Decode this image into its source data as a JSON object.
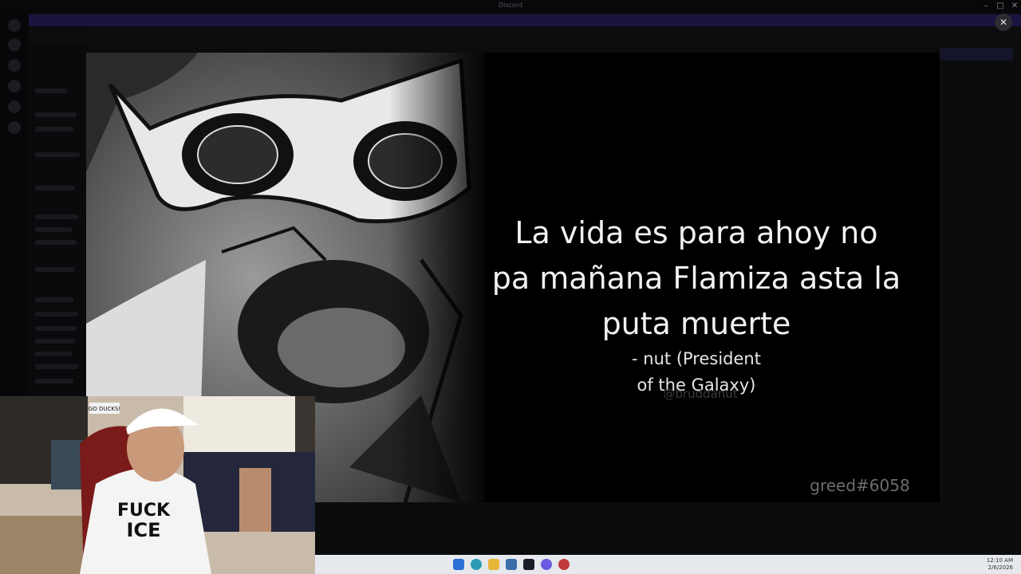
{
  "window": {
    "title": "Discord"
  },
  "background": {
    "banner_text": "",
    "server_name": "",
    "channel_name": ""
  },
  "viewer": {
    "quote": "La vida es para ahoy no\npa mañana Flamiza asta la\nputa muerte",
    "author": "- nut (President\nof the Galaxy)",
    "watermark": "@bruddanut",
    "tag": "greed#6058",
    "close_icon": "close-icon"
  },
  "webcam": {
    "shirt_text_1": "FUCK",
    "shirt_text_2": "ICE",
    "sign_text": "GO DUCKS!"
  },
  "taskbar": {
    "icons": [
      "windows-start-icon",
      "edge-icon",
      "file-explorer-icon",
      "store-icon",
      "terminal-icon",
      "discord-icon",
      "app-icon"
    ],
    "time": "12:10 AM",
    "date": "2/6/2026"
  },
  "colors": {
    "accent": "#1a1440",
    "taskbar": "#e5e8ed",
    "viewer_bg": "#000000"
  }
}
